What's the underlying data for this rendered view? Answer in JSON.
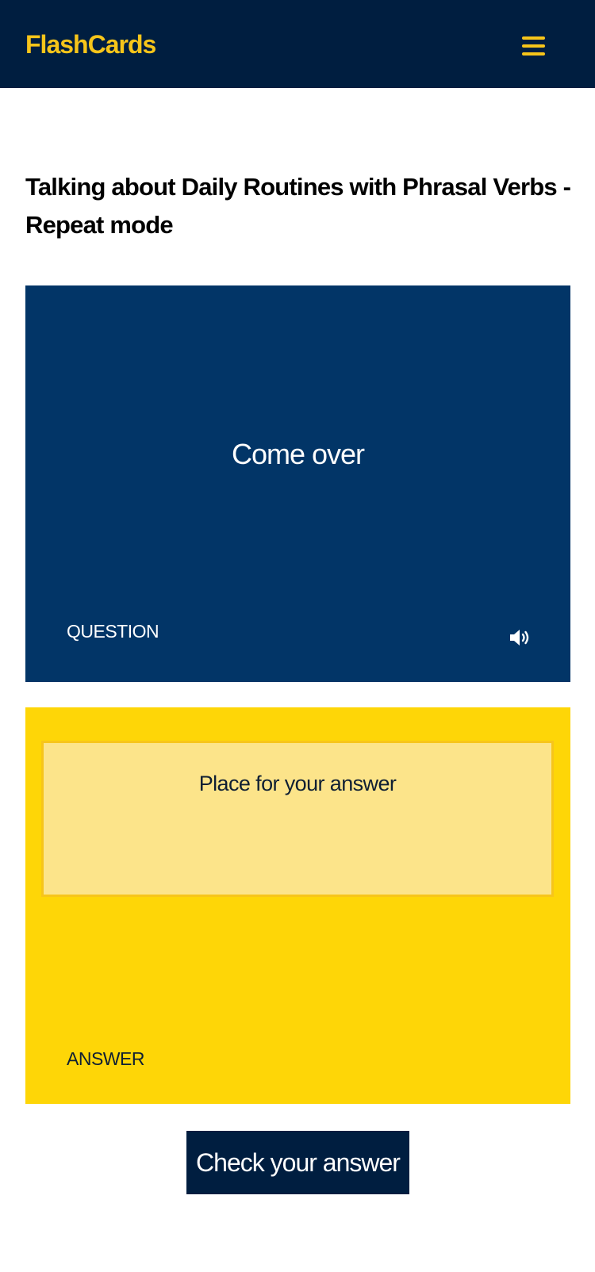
{
  "header": {
    "brand": "FlashCards",
    "menu_icon": "hamburger-menu-icon"
  },
  "page": {
    "title": "Talking about Daily Routines with Phrasal Verbs - Repeat mode"
  },
  "question_card": {
    "text": "Come over",
    "label": "QUESTION",
    "audio_icon": "speaker-volume-icon"
  },
  "answer_card": {
    "placeholder": "Place for your answer",
    "value": "",
    "label": "ANSWER"
  },
  "actions": {
    "check_label": "Check your answer"
  },
  "colors": {
    "navbar": "#001e40",
    "brand": "#f7c51a",
    "question_card": "#023567",
    "answer_card": "#fed607",
    "answer_input": "#fce48a",
    "button": "#001e40"
  }
}
